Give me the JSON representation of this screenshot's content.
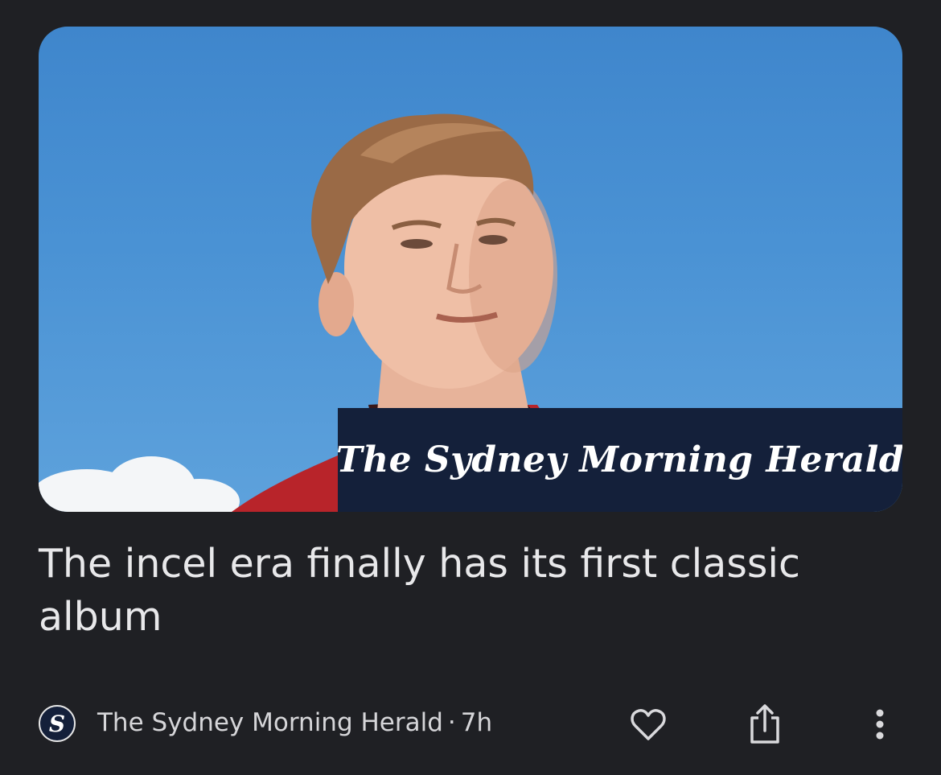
{
  "article": {
    "image_overlay_text": "The Sydney Morning Herald",
    "headline": "The incel era finally has its first classic album",
    "source_logo_letter": "S",
    "source_name": "The Sydney Morning Herald",
    "separator": "·",
    "age": "7h"
  },
  "actions": {
    "like_icon": "heart-outline-icon",
    "share_icon": "share-icon",
    "more_icon": "more-vertical-icon"
  },
  "colors": {
    "background": "#1f2024",
    "masthead": "#14203a",
    "text_primary": "#e8e8ea",
    "text_secondary": "#d6d6d9"
  }
}
